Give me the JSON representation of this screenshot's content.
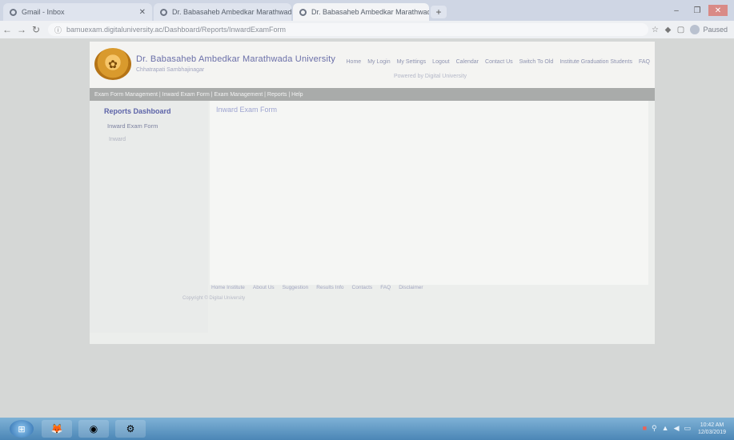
{
  "browser": {
    "tabs": [
      {
        "title": "Gmail - Inbox",
        "icon": "mail-icon"
      },
      {
        "title": "Dr. Babasaheb Ambedkar Marathwada University",
        "icon": "globe-icon"
      },
      {
        "title": "Dr. Babasaheb Ambedkar Marathwada University",
        "icon": "globe-icon"
      }
    ],
    "new_tab_label": "+",
    "address": "bamuexam.digitaluniversity.ac/Dashboard/Reports/InwardExamForm",
    "profile_label": "Paused",
    "window_controls": [
      "–",
      "❐",
      "✕"
    ]
  },
  "site": {
    "university_name": "Dr. Babasaheb Ambedkar Marathwada University",
    "university_sub": "Chhatrapati Sambhajinagar",
    "top_nav": [
      "Home",
      "My Login",
      "My Settings",
      "Logout",
      "Calendar",
      "Contact Us",
      "Switch To Old",
      "Institute Graduation Students",
      "FAQ"
    ],
    "tagline": "Powered by Digital University",
    "breadcrumb": "Exam Form Management  |  Inward Exam Form  |  Exam Management  |  Reports  |  Help"
  },
  "sidebar": {
    "heading": "Reports Dashboard",
    "item": "Inward Exam Form",
    "subitem": "Inward"
  },
  "main": {
    "title": "Inward Exam Form"
  },
  "footer": {
    "links": [
      "Home Institute",
      "About Us",
      "Suggestion",
      "Results Info",
      "Contacts",
      "FAQ",
      "Disclaimer"
    ],
    "copyright": "Copyright © Digital University"
  },
  "taskbar": {
    "start": "⊞",
    "apps": [
      {
        "glyph": "🦊",
        "name": "firefox-icon"
      },
      {
        "glyph": "◉",
        "name": "chrome-icon"
      },
      {
        "glyph": "⚙",
        "name": "settings-icon"
      }
    ],
    "clock_time": "10:42 AM",
    "clock_date": "12/03/2019"
  }
}
